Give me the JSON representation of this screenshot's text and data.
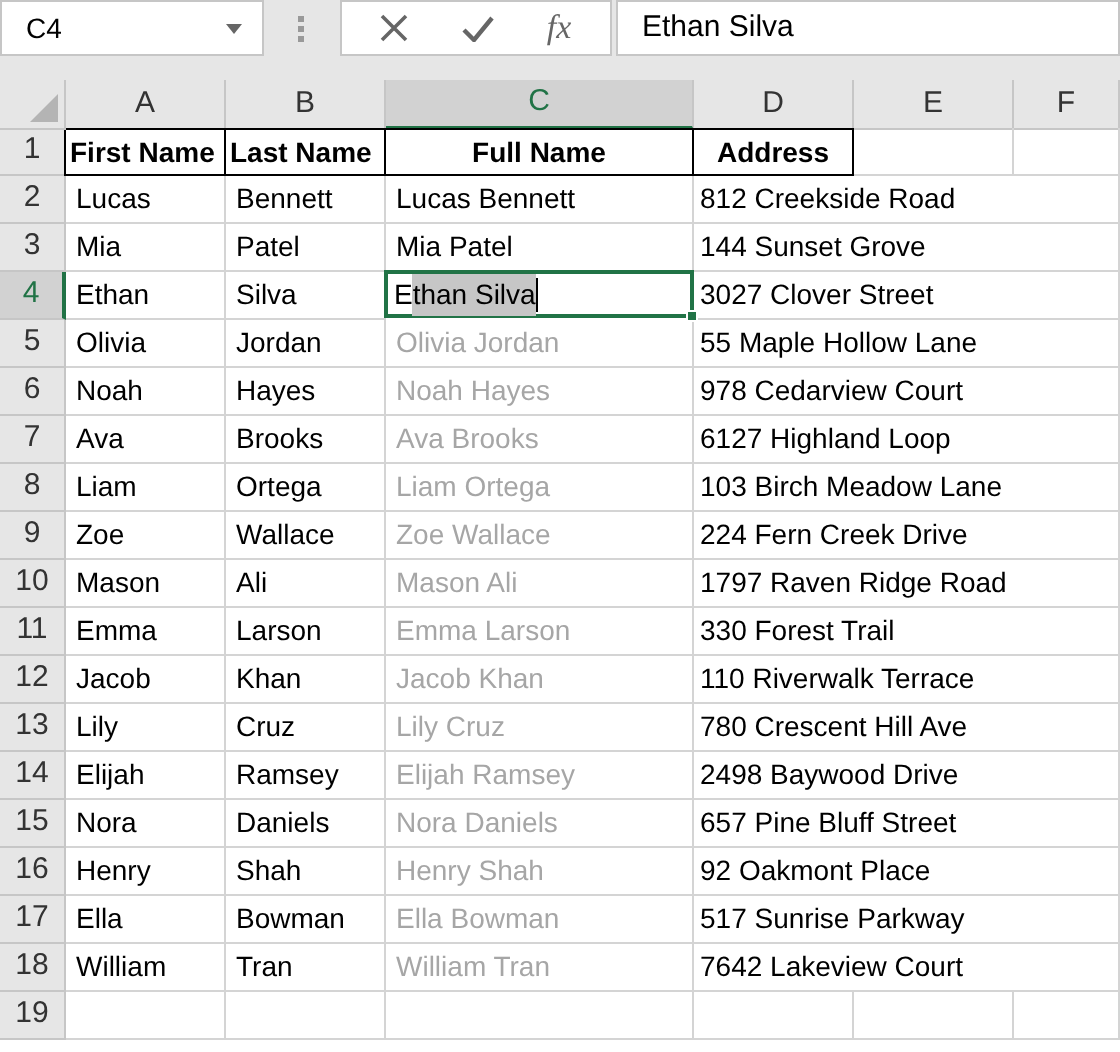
{
  "name_box": {
    "value": "C4"
  },
  "formula_bar": {
    "function_label": "fx",
    "value": "Ethan Silva"
  },
  "columns": [
    {
      "label": "A",
      "selected": false
    },
    {
      "label": "B",
      "selected": false
    },
    {
      "label": "C",
      "selected": true
    },
    {
      "label": "D",
      "selected": false
    },
    {
      "label": "E",
      "selected": false
    },
    {
      "label": "F",
      "selected": false
    }
  ],
  "rows": [
    {
      "number": "1",
      "selected": false,
      "bold": true,
      "cells": [
        {
          "kind": "value",
          "text": "First Name"
        },
        {
          "kind": "value",
          "text": "Last Name"
        },
        {
          "kind": "value",
          "text": "Full Name"
        },
        {
          "kind": "value",
          "text": "Address"
        }
      ]
    },
    {
      "number": "2",
      "selected": false,
      "bold": false,
      "cells": [
        {
          "kind": "value",
          "text": "Lucas"
        },
        {
          "kind": "value",
          "text": "Bennett"
        },
        {
          "kind": "value",
          "text": "Lucas Bennett"
        },
        {
          "kind": "value",
          "text": "812 Creekside Road"
        }
      ]
    },
    {
      "number": "3",
      "selected": false,
      "bold": false,
      "cells": [
        {
          "kind": "value",
          "text": "Mia"
        },
        {
          "kind": "value",
          "text": "Patel"
        },
        {
          "kind": "value",
          "text": "Mia Patel"
        },
        {
          "kind": "value",
          "text": "144 Sunset Grove"
        }
      ]
    },
    {
      "number": "4",
      "selected": true,
      "bold": false,
      "cells": [
        {
          "kind": "value",
          "text": "Ethan"
        },
        {
          "kind": "value",
          "text": "Silva"
        },
        {
          "kind": "editing",
          "typed": "E",
          "highlighted": "than Silva"
        },
        {
          "kind": "value",
          "text": "3027 Clover Street"
        }
      ]
    },
    {
      "number": "5",
      "selected": false,
      "bold": false,
      "cells": [
        {
          "kind": "value",
          "text": "Olivia"
        },
        {
          "kind": "value",
          "text": "Jordan"
        },
        {
          "kind": "suggestion",
          "text": "Olivia Jordan"
        },
        {
          "kind": "value",
          "text": "55 Maple Hollow Lane"
        }
      ]
    },
    {
      "number": "6",
      "selected": false,
      "bold": false,
      "cells": [
        {
          "kind": "value",
          "text": "Noah"
        },
        {
          "kind": "value",
          "text": "Hayes"
        },
        {
          "kind": "suggestion",
          "text": "Noah Hayes"
        },
        {
          "kind": "value",
          "text": "978 Cedarview Court"
        }
      ]
    },
    {
      "number": "7",
      "selected": false,
      "bold": false,
      "cells": [
        {
          "kind": "value",
          "text": "Ava"
        },
        {
          "kind": "value",
          "text": "Brooks"
        },
        {
          "kind": "suggestion",
          "text": "Ava Brooks"
        },
        {
          "kind": "value",
          "text": "6127 Highland Loop"
        }
      ]
    },
    {
      "number": "8",
      "selected": false,
      "bold": false,
      "cells": [
        {
          "kind": "value",
          "text": "Liam"
        },
        {
          "kind": "value",
          "text": "Ortega"
        },
        {
          "kind": "suggestion",
          "text": "Liam Ortega"
        },
        {
          "kind": "value",
          "text": "103 Birch Meadow Lane"
        }
      ]
    },
    {
      "number": "9",
      "selected": false,
      "bold": false,
      "cells": [
        {
          "kind": "value",
          "text": "Zoe"
        },
        {
          "kind": "value",
          "text": "Wallace"
        },
        {
          "kind": "suggestion",
          "text": "Zoe Wallace"
        },
        {
          "kind": "value",
          "text": "224 Fern Creek Drive"
        }
      ]
    },
    {
      "number": "10",
      "selected": false,
      "bold": false,
      "cells": [
        {
          "kind": "value",
          "text": "Mason"
        },
        {
          "kind": "value",
          "text": "Ali"
        },
        {
          "kind": "suggestion",
          "text": "Mason Ali"
        },
        {
          "kind": "value",
          "text": "1797 Raven Ridge Road"
        }
      ]
    },
    {
      "number": "11",
      "selected": false,
      "bold": false,
      "cells": [
        {
          "kind": "value",
          "text": "Emma"
        },
        {
          "kind": "value",
          "text": "Larson"
        },
        {
          "kind": "suggestion",
          "text": "Emma Larson"
        },
        {
          "kind": "value",
          "text": "330 Forest Trail"
        }
      ]
    },
    {
      "number": "12",
      "selected": false,
      "bold": false,
      "cells": [
        {
          "kind": "value",
          "text": "Jacob"
        },
        {
          "kind": "value",
          "text": "Khan"
        },
        {
          "kind": "suggestion",
          "text": "Jacob Khan"
        },
        {
          "kind": "value",
          "text": "110 Riverwalk Terrace"
        }
      ]
    },
    {
      "number": "13",
      "selected": false,
      "bold": false,
      "cells": [
        {
          "kind": "value",
          "text": "Lily"
        },
        {
          "kind": "value",
          "text": "Cruz"
        },
        {
          "kind": "suggestion",
          "text": "Lily Cruz"
        },
        {
          "kind": "value",
          "text": "780 Crescent Hill Ave"
        }
      ]
    },
    {
      "number": "14",
      "selected": false,
      "bold": false,
      "cells": [
        {
          "kind": "value",
          "text": "Elijah"
        },
        {
          "kind": "value",
          "text": "Ramsey"
        },
        {
          "kind": "suggestion",
          "text": "Elijah Ramsey"
        },
        {
          "kind": "value",
          "text": "2498 Baywood Drive"
        }
      ]
    },
    {
      "number": "15",
      "selected": false,
      "bold": false,
      "cells": [
        {
          "kind": "value",
          "text": "Nora"
        },
        {
          "kind": "value",
          "text": "Daniels"
        },
        {
          "kind": "suggestion",
          "text": "Nora Daniels"
        },
        {
          "kind": "value",
          "text": "657 Pine Bluff Street"
        }
      ]
    },
    {
      "number": "16",
      "selected": false,
      "bold": false,
      "cells": [
        {
          "kind": "value",
          "text": "Henry"
        },
        {
          "kind": "value",
          "text": "Shah"
        },
        {
          "kind": "suggestion",
          "text": "Henry Shah"
        },
        {
          "kind": "value",
          "text": "92 Oakmont Place"
        }
      ]
    },
    {
      "number": "17",
      "selected": false,
      "bold": false,
      "cells": [
        {
          "kind": "value",
          "text": "Ella"
        },
        {
          "kind": "value",
          "text": "Bowman"
        },
        {
          "kind": "suggestion",
          "text": "Ella Bowman"
        },
        {
          "kind": "value",
          "text": "517 Sunrise Parkway"
        }
      ]
    },
    {
      "number": "18",
      "selected": false,
      "bold": false,
      "cells": [
        {
          "kind": "value",
          "text": "William"
        },
        {
          "kind": "value",
          "text": "Tran"
        },
        {
          "kind": "suggestion",
          "text": "William Tran"
        },
        {
          "kind": "value",
          "text": "7642 Lakeview Court"
        }
      ]
    },
    {
      "number": "19",
      "selected": false,
      "cells": []
    }
  ]
}
